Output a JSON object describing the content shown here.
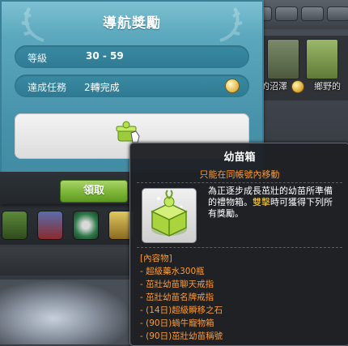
{
  "panel": {
    "title": "導航獎勵",
    "level_label": "等級",
    "level_value": "30 - 59",
    "task_label": "達成任務",
    "task_value": "2轉完成",
    "claim_button": "領取"
  },
  "background": {
    "thumb_labels": [
      "的沼澤",
      "鄉野的"
    ]
  },
  "tooltip": {
    "name": "幼苗箱",
    "restriction": "只能在同帳號內移動",
    "description_pre": "為正逐步成長茁壯的幼苗所準備的禮物箱。",
    "description_highlight": "雙擊",
    "description_post": "時可獲得下列所有獎勵。",
    "contents_header": "[內容物]",
    "contents": [
      "- 超級藥水300瓶",
      "- 茁壯幼苗聊天戒指",
      "- 茁壯幼苗名牌戒指",
      "- (14日)超級瞬移之石",
      "- (90日)蝸牛寵物箱",
      "- (90日)茁壯幼苗稱號"
    ]
  },
  "colors": {
    "panel_teal": "#4792aa",
    "claim_green": "#7fb83a",
    "restriction_orange": "#ff9a32",
    "highlight_yellow": "#ffcf3a"
  },
  "icons": {
    "reward_item": "green-gift-box-icon",
    "task_badge": "gold-coin-icon",
    "cursor": "glove-pointer-icon"
  }
}
